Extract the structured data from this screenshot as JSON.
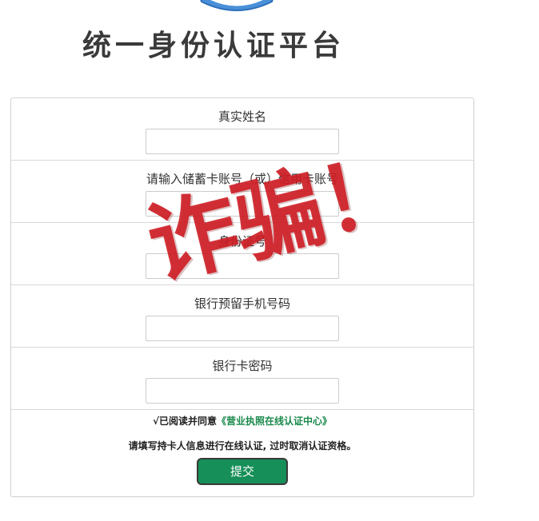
{
  "header": {
    "logo_icon": "shield-icon",
    "title": "统一身份认证平台"
  },
  "form": {
    "fields": [
      {
        "label": "真实姓名",
        "value": "",
        "placeholder": ""
      },
      {
        "label": "请输入储蓄卡账号（或）信用卡账号",
        "value": "",
        "placeholder": ""
      },
      {
        "label": "身份证号",
        "value": "",
        "placeholder": ""
      },
      {
        "label": "银行预留手机号码",
        "value": "",
        "placeholder": ""
      },
      {
        "label": "银行卡密码",
        "value": "",
        "placeholder": ""
      }
    ],
    "agreement": {
      "checkmark": "√",
      "prefix": "已阅读并同意",
      "link_text": "《营业执照在线认证中心》"
    },
    "notice": "请填写持卡人信息进行在线认证, 过时取消认证资格。",
    "submit_label": "提交"
  },
  "overlay": {
    "stamp_text": "诈骗！"
  },
  "colors": {
    "submit_button": "#168f58",
    "agreement_link": "#1a8a4c",
    "stamp": "#cd1c24",
    "logo": "#4a90d9"
  }
}
